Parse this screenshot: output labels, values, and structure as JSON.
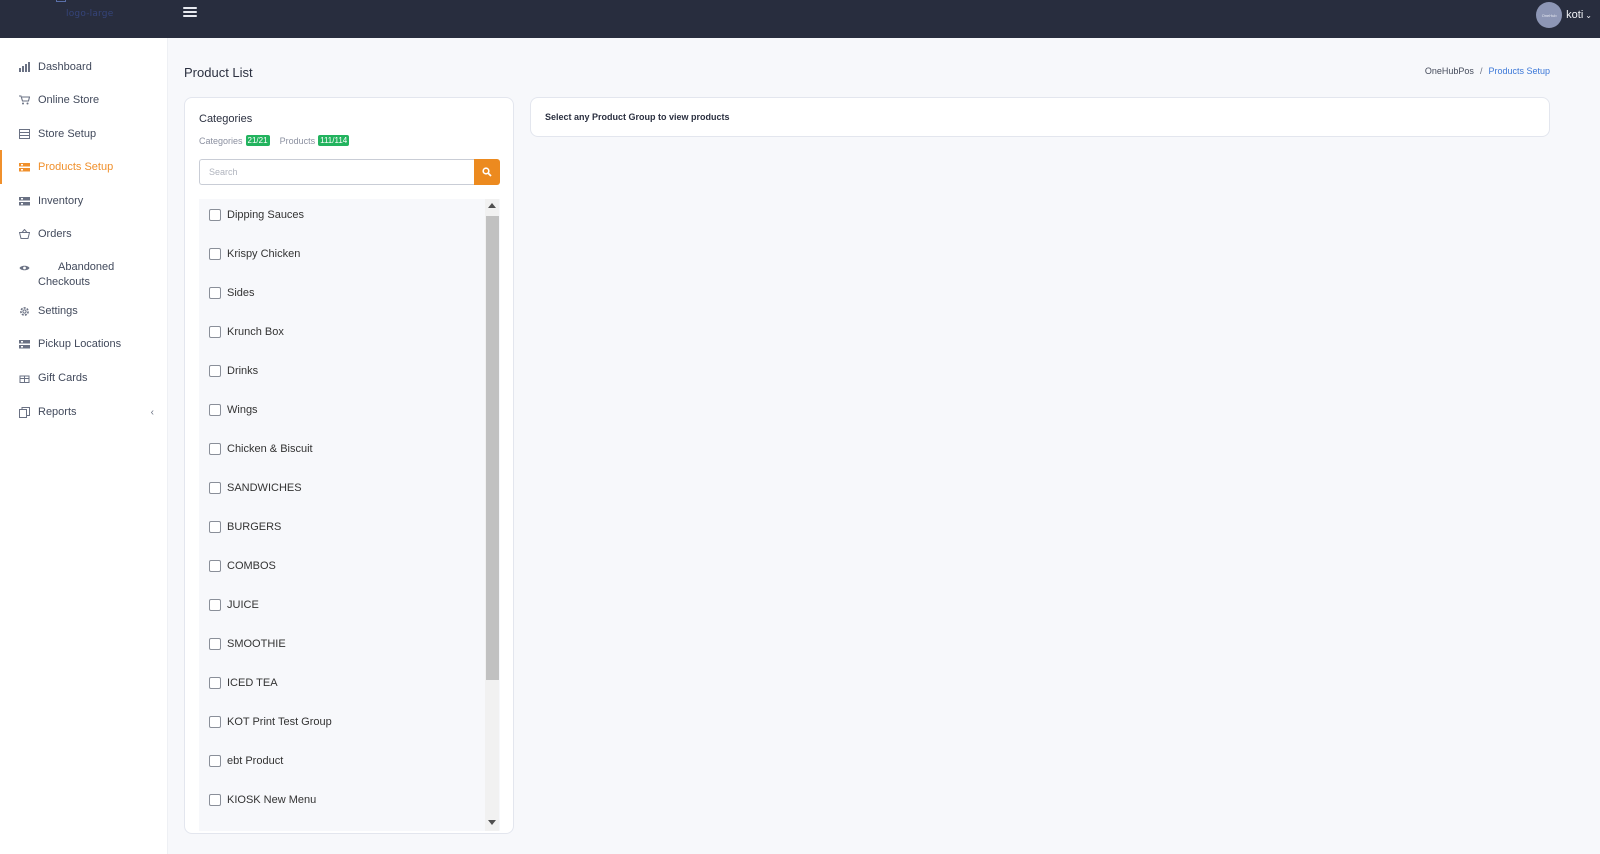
{
  "header": {
    "logo_text": "logo-large",
    "user": {
      "name": "koti",
      "avatar_text": "OneHub"
    }
  },
  "sidebar": {
    "items": [
      {
        "label": "Dashboard",
        "icon": "bar-chart-icon"
      },
      {
        "label": "Online Store",
        "icon": "cart-icon"
      },
      {
        "label": "Store Setup",
        "icon": "store-icon"
      },
      {
        "label": "Products Setup",
        "icon": "products-icon",
        "active": true
      },
      {
        "label": "Inventory",
        "icon": "inventory-icon"
      },
      {
        "label": "Orders",
        "icon": "basket-icon"
      },
      {
        "label": "Abandoned Checkouts",
        "icon": "eye-icon"
      },
      {
        "label": "Settings",
        "icon": "gear-icon"
      },
      {
        "label": "Pickup Locations",
        "icon": "location-icon"
      },
      {
        "label": "Gift Cards",
        "icon": "gift-icon"
      },
      {
        "label": "Reports",
        "icon": "report-icon"
      }
    ]
  },
  "main": {
    "page_title": "Product List",
    "breadcrumb": {
      "root": "OneHubPos",
      "separator": "/",
      "current": "Products Setup"
    },
    "categories_panel": {
      "title": "Categories",
      "categories_label": "Categories",
      "categories_count": "21/21",
      "products_label": "Products",
      "products_count": "111/114",
      "search_placeholder": "Search",
      "items": [
        "Dipping Sauces",
        "Krispy Chicken",
        "Sides",
        "Krunch Box",
        "Drinks",
        "Wings",
        "Chicken & Biscuit",
        "SANDWICHES",
        "BURGERS",
        "COMBOS",
        "JUICE",
        "SMOOTHIE",
        "ICED TEA",
        "KOT Print Test Group",
        "ebt Product",
        "KIOSK New Menu"
      ]
    },
    "products_panel": {
      "message": "Select any Product Group to view products"
    }
  },
  "colors": {
    "topbar": "#282d3e",
    "accent": "#f0902c",
    "search_button": "#ec8a1f",
    "badge": "#22b35e",
    "link": "#3c78d8"
  }
}
